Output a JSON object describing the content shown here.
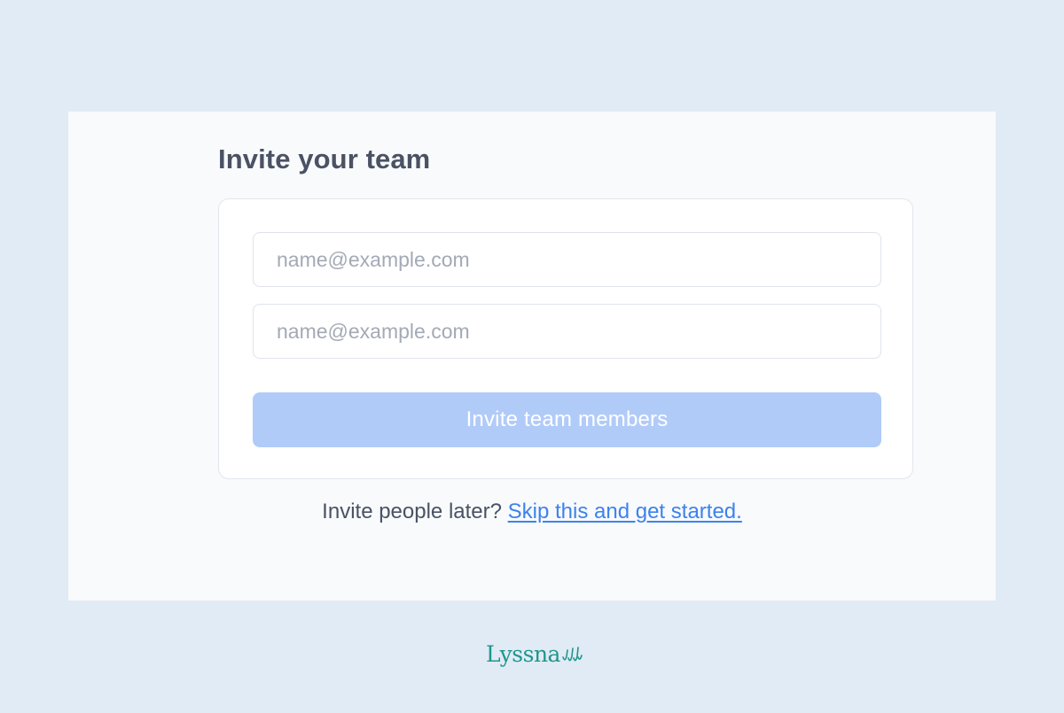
{
  "page": {
    "title": "Invite your team"
  },
  "form": {
    "email_1": {
      "placeholder": "name@example.com",
      "value": ""
    },
    "email_2": {
      "placeholder": "name@example.com",
      "value": ""
    },
    "invite_button_label": "Invite team members",
    "invite_button_state": "disabled"
  },
  "footer": {
    "prompt": "Invite people later?",
    "skip_link": "Skip this and get started."
  },
  "brand": {
    "logo_text": "Lyssna",
    "logo_icon": "wave-lines-icon"
  },
  "colors": {
    "background": "#e1ebf5",
    "panel": "#f8fafc",
    "button_disabled": "#b1cbf9",
    "link": "#3d82ec",
    "brand": "#1f968c",
    "heading": "#4a5263"
  }
}
